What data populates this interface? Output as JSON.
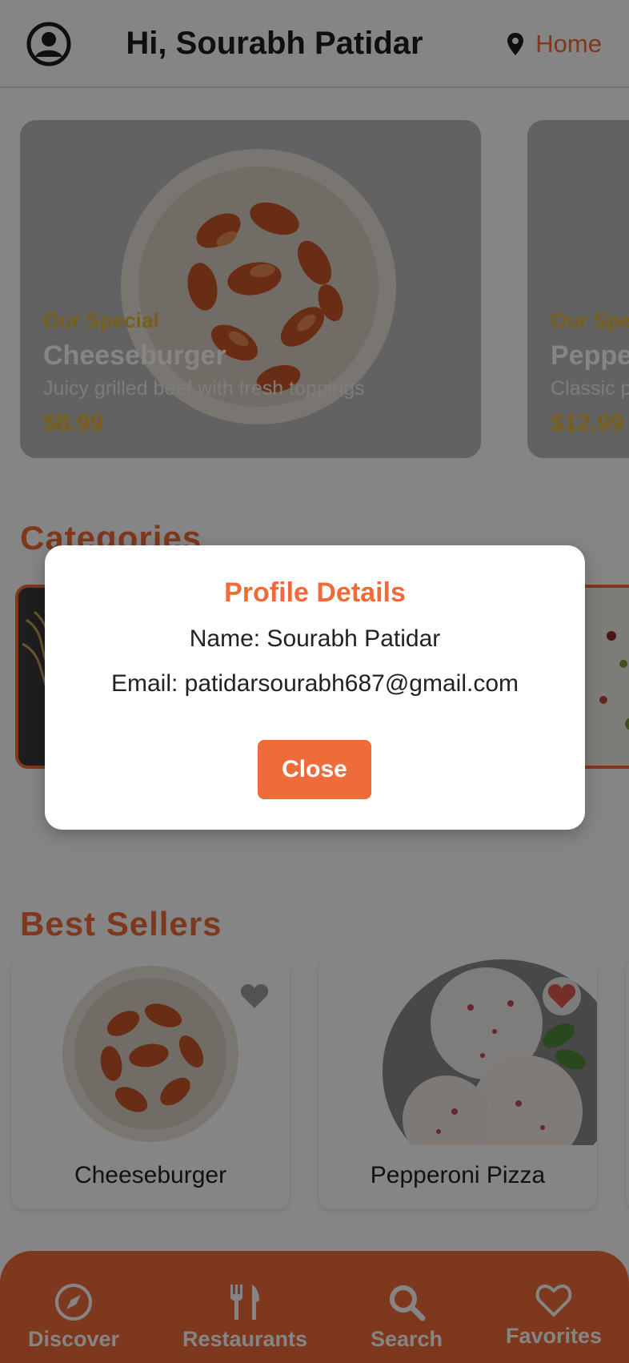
{
  "header": {
    "greeting": "Hi, Sourabh Patidar",
    "location_label": "Home",
    "avatar_icon": "account-circle-icon",
    "location_icon": "map-pin-icon"
  },
  "specials": [
    {
      "tag": "Our Special",
      "title": "Cheeseburger",
      "description": "Juicy grilled beef with fresh toppings",
      "price": "$8.99"
    },
    {
      "tag": "Our Special",
      "title": "Pepperoni Pizza",
      "description": "Classic pepperoni pizza",
      "price": "$12.99"
    }
  ],
  "categories": {
    "title": "Categories"
  },
  "best_sellers": {
    "title": "Best Sellers",
    "items": [
      {
        "name": "Cheeseburger",
        "favorite": false
      },
      {
        "name": "Pepperoni Pizza",
        "favorite": true
      }
    ]
  },
  "modal": {
    "title": "Profile Details",
    "name_line": "Name: Sourabh Patidar",
    "email_line": "Email: patidarsourabh687@gmail.com",
    "close_label": "Close"
  },
  "tabs": [
    {
      "label": "Discover",
      "icon": "compass-icon"
    },
    {
      "label": "Restaurants",
      "icon": "fork-knife-icon"
    },
    {
      "label": "Search",
      "icon": "search-icon"
    },
    {
      "label": "Favorites",
      "icon": "heart-outline-icon"
    }
  ],
  "colors": {
    "accent": "#ef6c3a",
    "special_tag": "#e7b733",
    "favorite_heart": "#e05a4f"
  }
}
